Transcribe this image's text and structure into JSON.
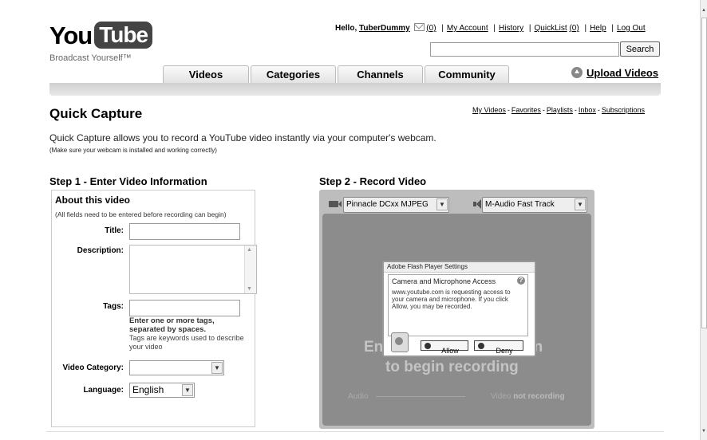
{
  "logo": {
    "you": "You",
    "tube": "Tube",
    "tagline": "Broadcast Yourself™"
  },
  "header": {
    "greeting": "Hello,",
    "username": "TuberDummy",
    "inbox_count": "(0)",
    "links": {
      "my_account": "My Account",
      "history": "History",
      "quicklist": "QuickList",
      "quicklist_count": "(0)",
      "help": "Help",
      "logout": "Log Out"
    },
    "separator": "|",
    "search_placeholder": "",
    "search_label": "Search"
  },
  "nav": {
    "tabs": [
      "Videos",
      "Categories",
      "Channels",
      "Community"
    ],
    "upload": "Upload Videos"
  },
  "page": {
    "title": "Quick Capture",
    "sublinks": [
      "My Videos",
      "Favorites",
      "Playlists",
      "Inbox",
      "Subscriptions"
    ],
    "sublink_sep": "-",
    "intro": "Quick Capture allows you to record a YouTube video instantly via your computer's webcam.",
    "intro_note": "(Make sure your webcam is installed and working correctly)"
  },
  "step1": {
    "heading": "Step 1 - Enter Video Information",
    "about_title": "About this video",
    "about_note": "(All fields need to be entered before recording can begin)",
    "title_label": "Title:",
    "title_value": "",
    "description_label": "Description:",
    "tags_label": "Tags:",
    "tags_value": "",
    "tags_help_bold": "Enter one or more tags, separated by spaces.",
    "tags_help": "Tags are keywords used to describe your video",
    "category_label": "Video Category:",
    "category_value": "",
    "language_label": "Language:",
    "language_value": "English"
  },
  "step2": {
    "heading": "Step 2 - Record Video",
    "camera": "Pinnacle DCxx MJPEG",
    "microphone": "M-Audio Fast Track",
    "enable_left": "En",
    "enable_right": "on",
    "begin": "to begin recording",
    "audio_label": "Audio",
    "video_label": "Video",
    "video_state": "not recording"
  },
  "flash": {
    "window_title": "Adobe Flash Player Settings",
    "heading": "Camera and Microphone Access",
    "message": "www.youtube.com is requesting access to your camera and microphone. If you click Allow, you may be recorded.",
    "allow": "Allow",
    "deny": "Deny",
    "help": "?"
  }
}
